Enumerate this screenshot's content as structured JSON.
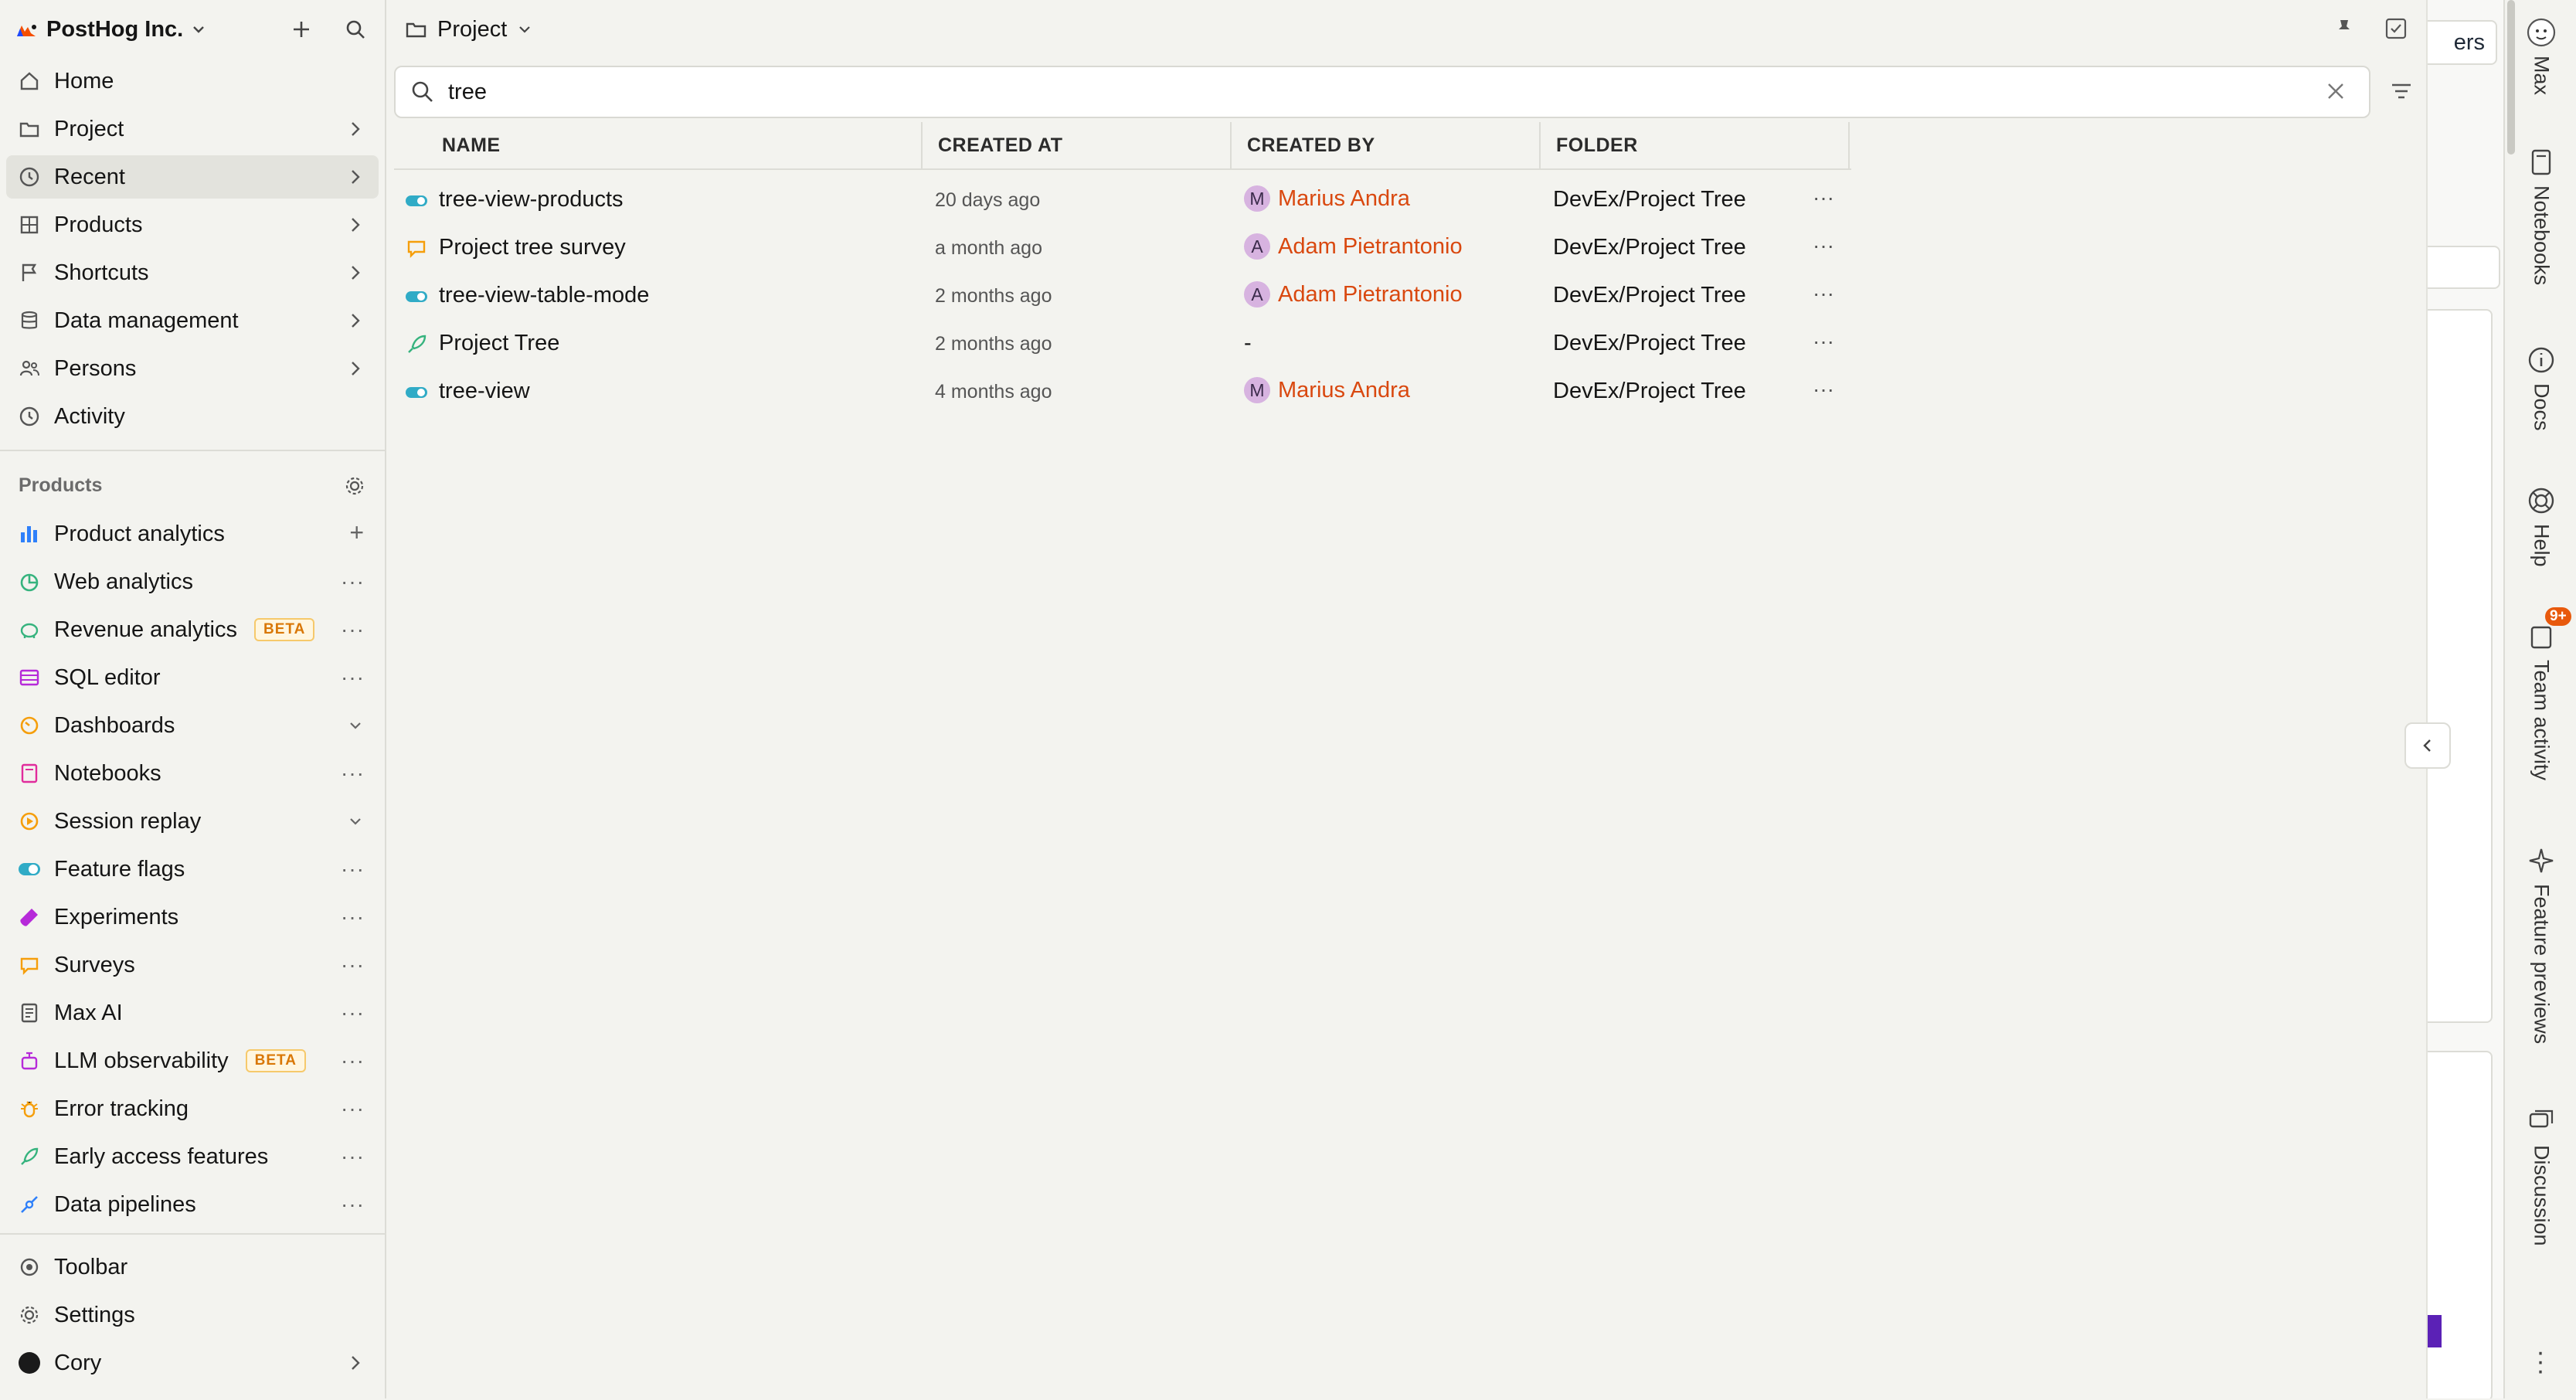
{
  "sidebar": {
    "org_name": "PostHog Inc.",
    "nav": [
      {
        "label": "Home",
        "icon": "home-icon"
      },
      {
        "label": "Project",
        "icon": "folder-icon"
      },
      {
        "label": "Recent",
        "icon": "clock-icon"
      },
      {
        "label": "Products",
        "icon": "products-icon"
      },
      {
        "label": "Shortcuts",
        "icon": "flag-icon"
      },
      {
        "label": "Data management",
        "icon": "database-icon"
      },
      {
        "label": "Persons",
        "icon": "persons-icon"
      },
      {
        "label": "Activity",
        "icon": "clock-icon"
      }
    ],
    "products_title": "Products",
    "products": [
      {
        "label": "Product analytics",
        "icon": "bar-chart-icon",
        "color": "#2f80fa"
      },
      {
        "label": "Web analytics",
        "icon": "pie-icon",
        "color": "#36b37e"
      },
      {
        "label": "Revenue analytics",
        "icon": "piggy-icon",
        "color": "#36b37e",
        "badge": "BETA"
      },
      {
        "label": "SQL editor",
        "icon": "table-icon",
        "color": "#b62ad9"
      },
      {
        "label": "Dashboards",
        "icon": "gauge-icon",
        "color": "#f59e0b"
      },
      {
        "label": "Notebooks",
        "icon": "notebook-icon",
        "color": "#e02c9c"
      },
      {
        "label": "Session replay",
        "icon": "replay-icon",
        "color": "#f59e0b"
      },
      {
        "label": "Feature flags",
        "icon": "toggle-icon",
        "color": "#30abc6"
      },
      {
        "label": "Experiments",
        "icon": "flask-icon",
        "color": "#b62ad9"
      },
      {
        "label": "Surveys",
        "icon": "chat-icon",
        "color": "#f59e0b"
      },
      {
        "label": "Max AI",
        "icon": "doc-icon",
        "color": "#555555"
      },
      {
        "label": "LLM observability",
        "icon": "llm-icon",
        "color": "#b62ad9",
        "badge": "BETA"
      },
      {
        "label": "Error tracking",
        "icon": "bug-icon",
        "color": "#f59e0b"
      },
      {
        "label": "Early access features",
        "icon": "rocket-icon",
        "color": "#36b37e"
      },
      {
        "label": "Data pipelines",
        "icon": "pipeline-icon",
        "color": "#2f80fa"
      }
    ],
    "bottom": [
      {
        "label": "Toolbar",
        "icon": "toolbar-icon"
      },
      {
        "label": "Settings",
        "icon": "gear-icon"
      },
      {
        "label": "Cory",
        "icon": "user-avatar"
      }
    ]
  },
  "main": {
    "breadcrumb": "Project",
    "search": {
      "value": "tree"
    },
    "columns": [
      "NAME",
      "CREATED AT",
      "CREATED BY",
      "FOLDER"
    ],
    "rows": [
      {
        "name": "tree-view-products",
        "icon": "toggle-icon",
        "created_at": "20 days ago",
        "avatar": "M",
        "created_by": "Marius Andra",
        "folder": "DevEx/Project Tree"
      },
      {
        "name": "Project tree survey",
        "icon": "chat-icon",
        "created_at": "a month ago",
        "avatar": "A",
        "created_by": "Adam Pietrantonio",
        "folder": "DevEx/Project Tree"
      },
      {
        "name": "tree-view-table-mode",
        "icon": "toggle-icon",
        "created_at": "2 months ago",
        "avatar": "A",
        "created_by": "Adam Pietrantonio",
        "folder": "DevEx/Project Tree"
      },
      {
        "name": "Project Tree",
        "icon": "rocket-icon",
        "created_at": "2 months ago",
        "avatar": "",
        "created_by": "-",
        "folder": "DevEx/Project Tree"
      },
      {
        "name": "tree-view",
        "icon": "toggle-icon",
        "created_at": "4 months ago",
        "avatar": "M",
        "created_by": "Marius Andra",
        "folder": "DevEx/Project Tree"
      }
    ]
  },
  "overflow": {
    "partial_button": "ers"
  },
  "rightbar": {
    "items": [
      {
        "label": "Max",
        "icon": "hedgehog-avatar-icon"
      },
      {
        "label": "Notebooks",
        "icon": "notebook-icon"
      },
      {
        "label": "Docs",
        "icon": "info-icon"
      },
      {
        "label": "Help",
        "icon": "lifebuoy-icon"
      },
      {
        "label": "Team activity",
        "icon": "inbox-icon",
        "badge": "9+"
      },
      {
        "label": "Feature previews",
        "icon": "sparkle-icon"
      },
      {
        "label": "Discussion",
        "icon": "discussion-icon"
      }
    ]
  }
}
